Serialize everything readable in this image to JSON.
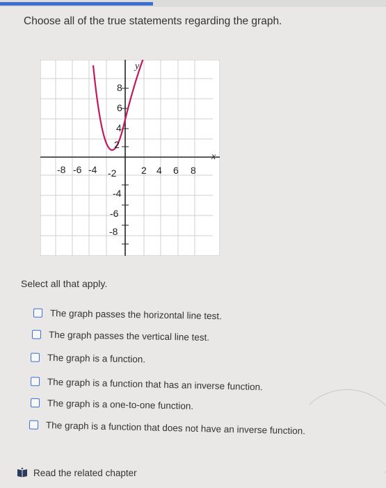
{
  "question": {
    "text": "Choose all of the true statements regarding the graph."
  },
  "graph": {
    "x_axis_label": "x",
    "y_axis_label": "y",
    "x_tick_labels_negative": [
      "-8",
      "-6",
      "-4"
    ],
    "x_tick_labels_positive": [
      "2",
      "4",
      "6",
      "8"
    ],
    "y_tick_labels_positive": [
      "8",
      "6",
      "4",
      "2"
    ],
    "y_tick_labels_negative": [
      "-2",
      "-4",
      "-6",
      "-8"
    ],
    "curve": "parabola"
  },
  "instructions": {
    "text": "Select all that apply."
  },
  "options": [
    {
      "label": "The graph passes the horizontal line test.",
      "checked": false
    },
    {
      "label": "The graph passes the vertical line test.",
      "checked": false
    },
    {
      "label": "The graph is a function.",
      "checked": false
    },
    {
      "label": "The graph is a function that has an inverse function.",
      "checked": false
    },
    {
      "label": "The graph is a one-to-one function.",
      "checked": false
    },
    {
      "label": "The graph is a function that does not have an inverse function.",
      "checked": false
    }
  ],
  "footer": {
    "link_text": "Read the related chapter",
    "icon": "book-icon"
  },
  "colors": {
    "accent": "#3b6fd1",
    "curve": "#c2185b"
  }
}
